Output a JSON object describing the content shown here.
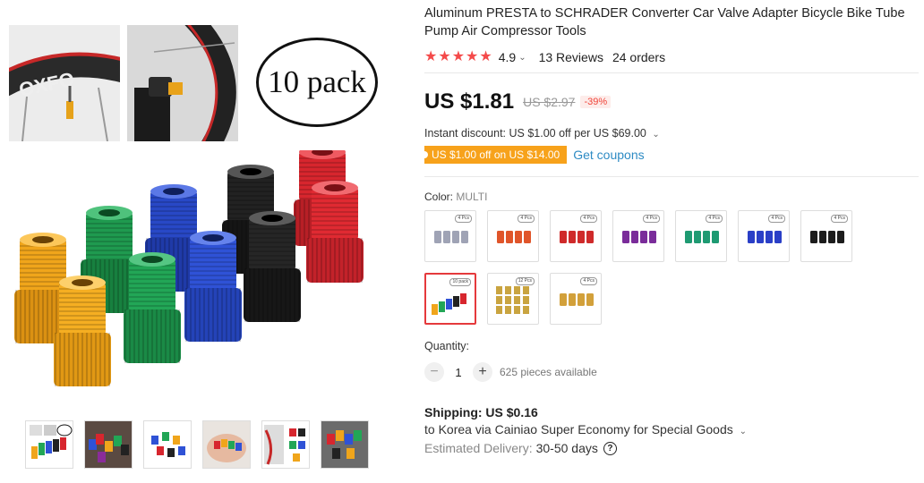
{
  "product": {
    "title": "Aluminum PRESTA to SCHRADER Converter Car Valve Adapter Bicycle Bike Tube Pump Air Compressor Tools",
    "pack_badge": "10 pack",
    "rating": "4.9",
    "reviews": "13 Reviews",
    "orders": "24 orders",
    "price": "US $1.81",
    "old_price": "US $2.97",
    "discount": "-39%",
    "instant_discount": "Instant discount: US $1.00 off per US $69.00",
    "coupon_tag": "US $1.00 off on US $14.00",
    "coupon_link": "Get coupons"
  },
  "colors": {
    "accent": "#f44a4a",
    "coupon": "#f7a21b",
    "link": "#2e8bc4"
  },
  "color_option": {
    "label": "Color:",
    "value": "MULTI",
    "swatches": [
      {
        "name": "silver",
        "tag": "4 Pcs",
        "color": "#9fa3b5"
      },
      {
        "name": "orange-red",
        "tag": "4 Pcs",
        "color": "#e0552a"
      },
      {
        "name": "red",
        "tag": "4 Pcs",
        "color": "#cf2a2a"
      },
      {
        "name": "purple",
        "tag": "4 Pcs",
        "color": "#7a2c9a"
      },
      {
        "name": "green",
        "tag": "4 Pcs",
        "color": "#1e9a72"
      },
      {
        "name": "blue",
        "tag": "4 Pcs",
        "color": "#2a3fc7"
      },
      {
        "name": "black",
        "tag": "4 Pcs",
        "color": "#1c1c1c"
      },
      {
        "name": "multi",
        "tag": "10 pack",
        "color": "#e5393c"
      },
      {
        "name": "gold-12",
        "tag": "12 Pcs",
        "color": "#c9a440"
      },
      {
        "name": "gold-4",
        "tag": "4 Pcs",
        "color": "#d2a03a"
      }
    ]
  },
  "quantity": {
    "label": "Quantity:",
    "value": "1",
    "minus": "−",
    "plus": "+",
    "available": "625 pieces available"
  },
  "shipping": {
    "title": "Shipping: US $0.16",
    "destination": "to Korea via Cainiao Super Economy for Special Goods",
    "delivery_label": "Estimated Delivery:",
    "delivery_days": "30-50 days",
    "help": "?"
  },
  "thumbnails": [
    "thumb-1",
    "thumb-2",
    "thumb-3",
    "thumb-4",
    "thumb-5",
    "thumb-6"
  ]
}
